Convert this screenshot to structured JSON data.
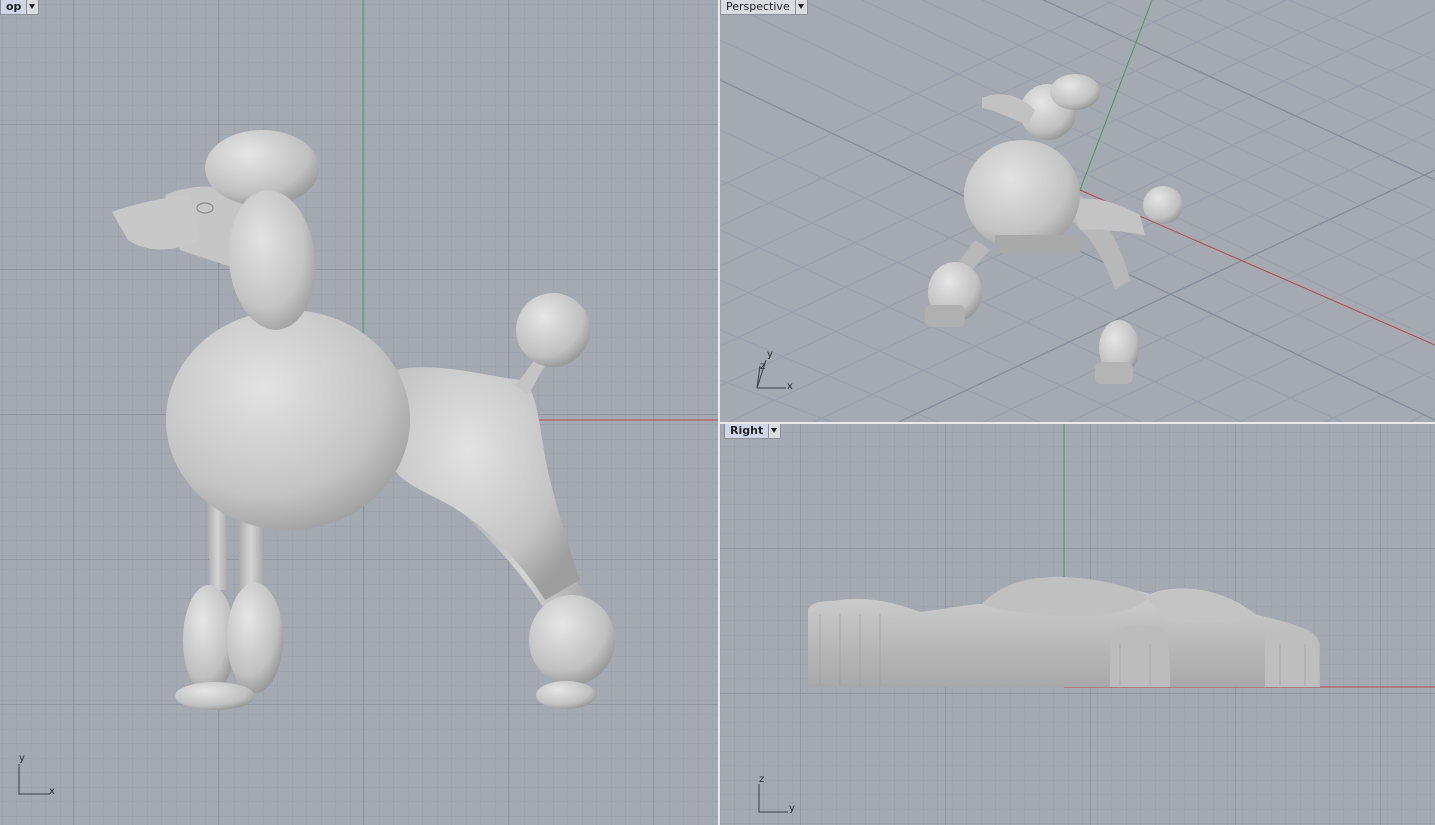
{
  "viewports": {
    "top": {
      "label": "op",
      "axis_v": "y",
      "axis_h": "x"
    },
    "perspective": {
      "label": "Perspective",
      "axis_v": "y",
      "axis_z": "z",
      "axis_h": "x"
    },
    "right": {
      "label": "Right",
      "axis_v": "z",
      "axis_h": "y"
    }
  },
  "colors": {
    "viewport_bg": "#a4a9b2",
    "grid_minor": "#97a0ad",
    "grid_major": "#858d99",
    "axis_x": "#b84a4a",
    "axis_y": "#3fa04a",
    "model": "#c8c8c8"
  }
}
